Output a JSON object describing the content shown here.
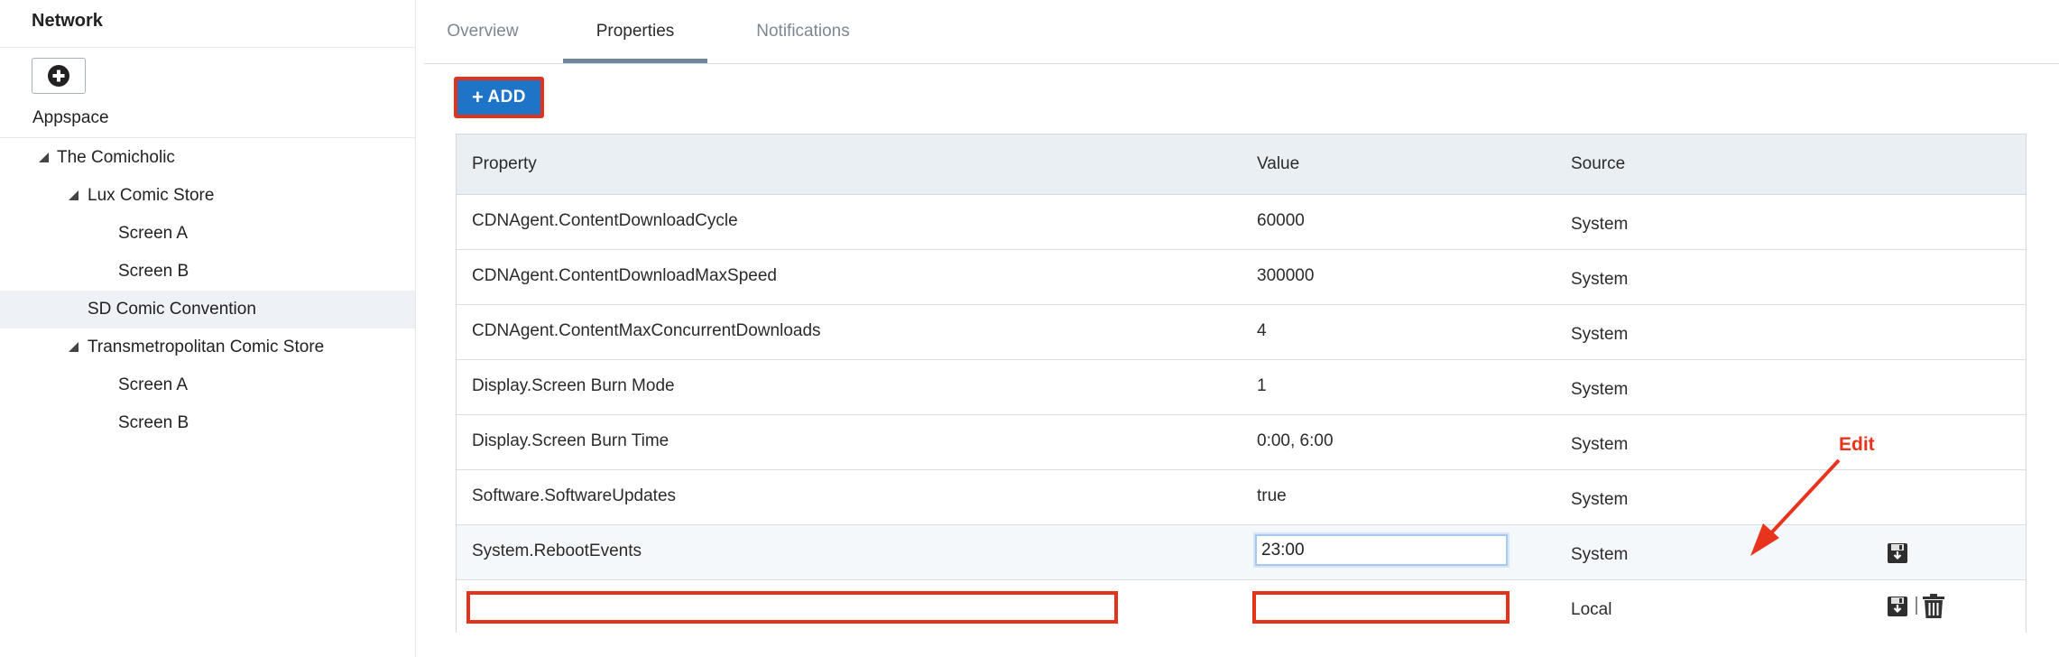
{
  "sidebar": {
    "title": "Network",
    "add_icon": "plus-circle-icon",
    "section_label": "Appspace",
    "tree": [
      {
        "label": "The Comicholic",
        "level": 1,
        "expanded": true
      },
      {
        "label": "Lux Comic Store",
        "level": 2,
        "expanded": true
      },
      {
        "label": "Screen A",
        "level": 3
      },
      {
        "label": "Screen B",
        "level": 3
      },
      {
        "label": "SD Comic Convention",
        "level": 2,
        "selected": true
      },
      {
        "label": "Transmetropolitan Comic Store",
        "level": 2,
        "expanded": true
      },
      {
        "label": "Screen A",
        "level": 3
      },
      {
        "label": "Screen B",
        "level": 3
      }
    ]
  },
  "tabs": [
    {
      "label": "Overview"
    },
    {
      "label": "Properties",
      "active": true
    },
    {
      "label": "Notifications"
    }
  ],
  "toolbar": {
    "add_label": "ADD",
    "add_icon": "plus-icon"
  },
  "table": {
    "columns": [
      "Property",
      "Value",
      "Source"
    ],
    "rows": [
      {
        "property": "CDNAgent.ContentDownloadCycle",
        "value": "60000",
        "source": "System"
      },
      {
        "property": "CDNAgent.ContentDownloadMaxSpeed",
        "value": "300000",
        "source": "System"
      },
      {
        "property": "CDNAgent.ContentMaxConcurrentDownloads",
        "value": "4",
        "source": "System"
      },
      {
        "property": "Display.Screen Burn Mode",
        "value": "1",
        "source": "System"
      },
      {
        "property": "Display.Screen Burn Time",
        "value": "0:00, 6:00",
        "source": "System"
      },
      {
        "property": "Software.SoftwareUpdates",
        "value": "true",
        "source": "System"
      }
    ],
    "editing_row": {
      "property": "System.RebootEvents",
      "value": "23:00",
      "source": "System",
      "save_icon": "save-icon"
    },
    "new_row": {
      "property": "",
      "value": "",
      "source": "Local",
      "save_icon": "save-icon",
      "delete_icon": "trash-icon"
    }
  },
  "annotation": {
    "label": "Edit",
    "color": "#e8341c"
  },
  "colors": {
    "accent": "#1e74c6",
    "highlight": "#e2331c",
    "header_bg": "#eaeff3"
  }
}
